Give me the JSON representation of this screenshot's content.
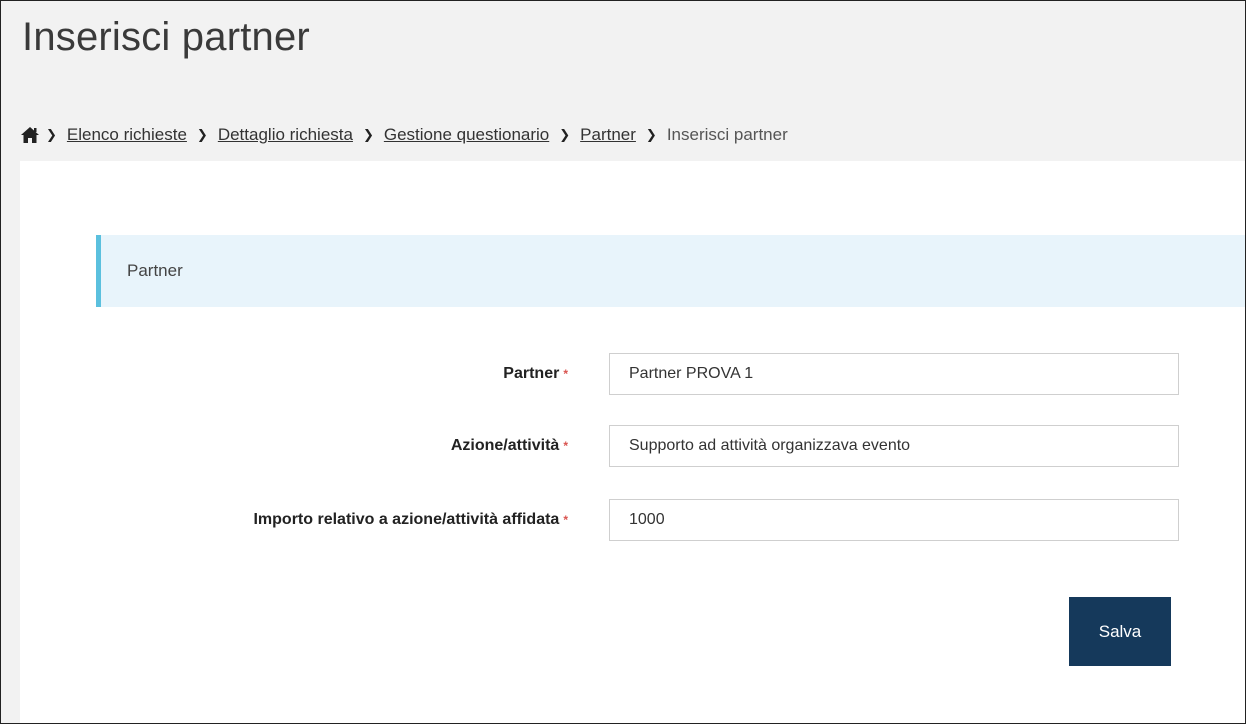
{
  "page": {
    "title": "Inserisci partner"
  },
  "breadcrumb": {
    "home_icon": "home-icon",
    "items": [
      {
        "label": "Elenco richieste"
      },
      {
        "label": "Dettaglio richiesta"
      },
      {
        "label": "Gestione questionario"
      },
      {
        "label": "Partner"
      }
    ],
    "current": "Inserisci partner"
  },
  "panel": {
    "heading": "Partner",
    "accent_color": "#5bc0de"
  },
  "form": {
    "required_marker": "*",
    "fields": [
      {
        "label": "Partner",
        "value": "Partner PROVA 1"
      },
      {
        "label": "Azione/attività",
        "value": "Supporto ad attività organizzava evento"
      },
      {
        "label": "Importo relativo a azione/attività affidata",
        "value": "1000"
      }
    ],
    "save_label": "Salva",
    "save_color": "#15395b"
  }
}
